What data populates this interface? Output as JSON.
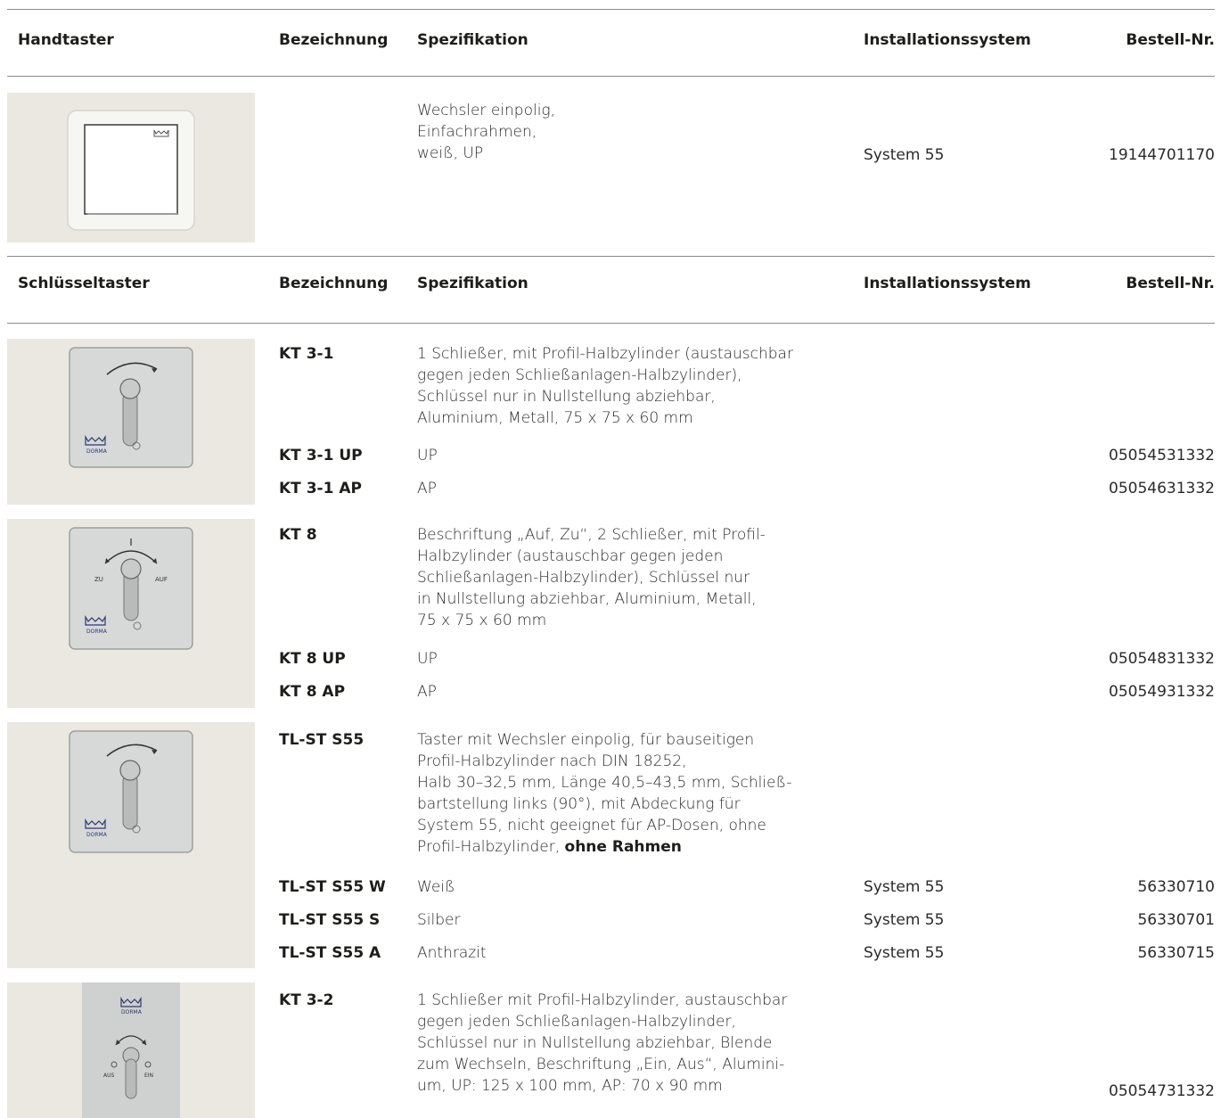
{
  "section1": {
    "headers": {
      "category": "Handtaster",
      "designation": "Bezeichnung",
      "spec": "Spezifikation",
      "system": "Installationssystem",
      "order": "Bestell-Nr."
    },
    "item": {
      "spec": "Wechsler einpolig,\nEinfachrahmen,\nweiß, UP",
      "system": "System 55",
      "order": "19144701170"
    }
  },
  "section2": {
    "headers": {
      "category": "Schlüsseltaster",
      "designation": "Bezeichnung",
      "spec": "Spezifikation",
      "system": "Installationssystem",
      "order": "Bestell-Nr."
    },
    "groups": [
      {
        "code": "KT 3-1",
        "spec": "1 Schließer, mit Profil-Halbzylinder (austauschbar\ngegen jeden Schließanlagen-Halbzylinder),\nSchlüssel nur in Nullstellung abziehbar,\nAluminium, Metall, 75 x 75 x 60 mm",
        "variants": [
          {
            "code": "KT 3-1 UP",
            "spec": "UP",
            "order": "05054531332"
          },
          {
            "code": "KT 3-1 AP",
            "spec": "AP",
            "order": "05054631332"
          }
        ]
      },
      {
        "code": "KT 8",
        "spec": "Beschriftung „Auf, Zu“, 2 Schließer, mit Profil-\nHalbzylinder (austauschbar gegen jeden\nSchließanlagen-Halbzylinder), Schlüssel nur\nin Nullstellung abziehbar, Aluminium, Metall,\n75 x 75 x 60 mm",
        "labels": {
          "left": "ZU",
          "right": "AUF"
        },
        "variants": [
          {
            "code": "KT 8 UP",
            "spec": "UP",
            "order": "05054831332"
          },
          {
            "code": "KT 8 AP",
            "spec": "AP",
            "order": "05054931332"
          }
        ]
      },
      {
        "code": "TL-ST S55",
        "spec": "Taster mit Wechsler einpolig, für bauseitigen\nProfil-Halbzylinder nach DIN 18252,\nHalb 30–32,5 mm, Länge 40,5–43,5 mm, Schließ-\nbartstellung links (90°), mit Abdeckung für\nSystem 55, nicht geeignet für AP-Dosen, ohne\nProfil-Halbzylinder, ",
        "spec_bold": "ohne Rahmen",
        "variants": [
          {
            "code": "TL-ST S55 W",
            "spec": "Weiß",
            "system": "System 55",
            "order": "56330710"
          },
          {
            "code": "TL-ST S55 S",
            "spec": "Silber",
            "system": "System 55",
            "order": "56330701"
          },
          {
            "code": "TL-ST S55 A",
            "spec": "Anthrazit",
            "system": "System 55",
            "order": "56330715"
          }
        ]
      },
      {
        "code": "KT 3-2",
        "spec": "1 Schließer mit Profil-Halbzylinder, austauschbar\ngegen jeden Schließanlagen-Halbzylinder,\nSchlüssel nur in Nullstellung abziehbar, Blende\nzum Wechseln, Beschriftung „Ein, Aus“, Alumini-\num, UP: 125 x 100 mm, AP: 70 x 90 mm",
        "order": "05054731332",
        "labels": {
          "left": "AUS",
          "right": "EIN"
        }
      }
    ]
  },
  "logo_text": "DORMA"
}
